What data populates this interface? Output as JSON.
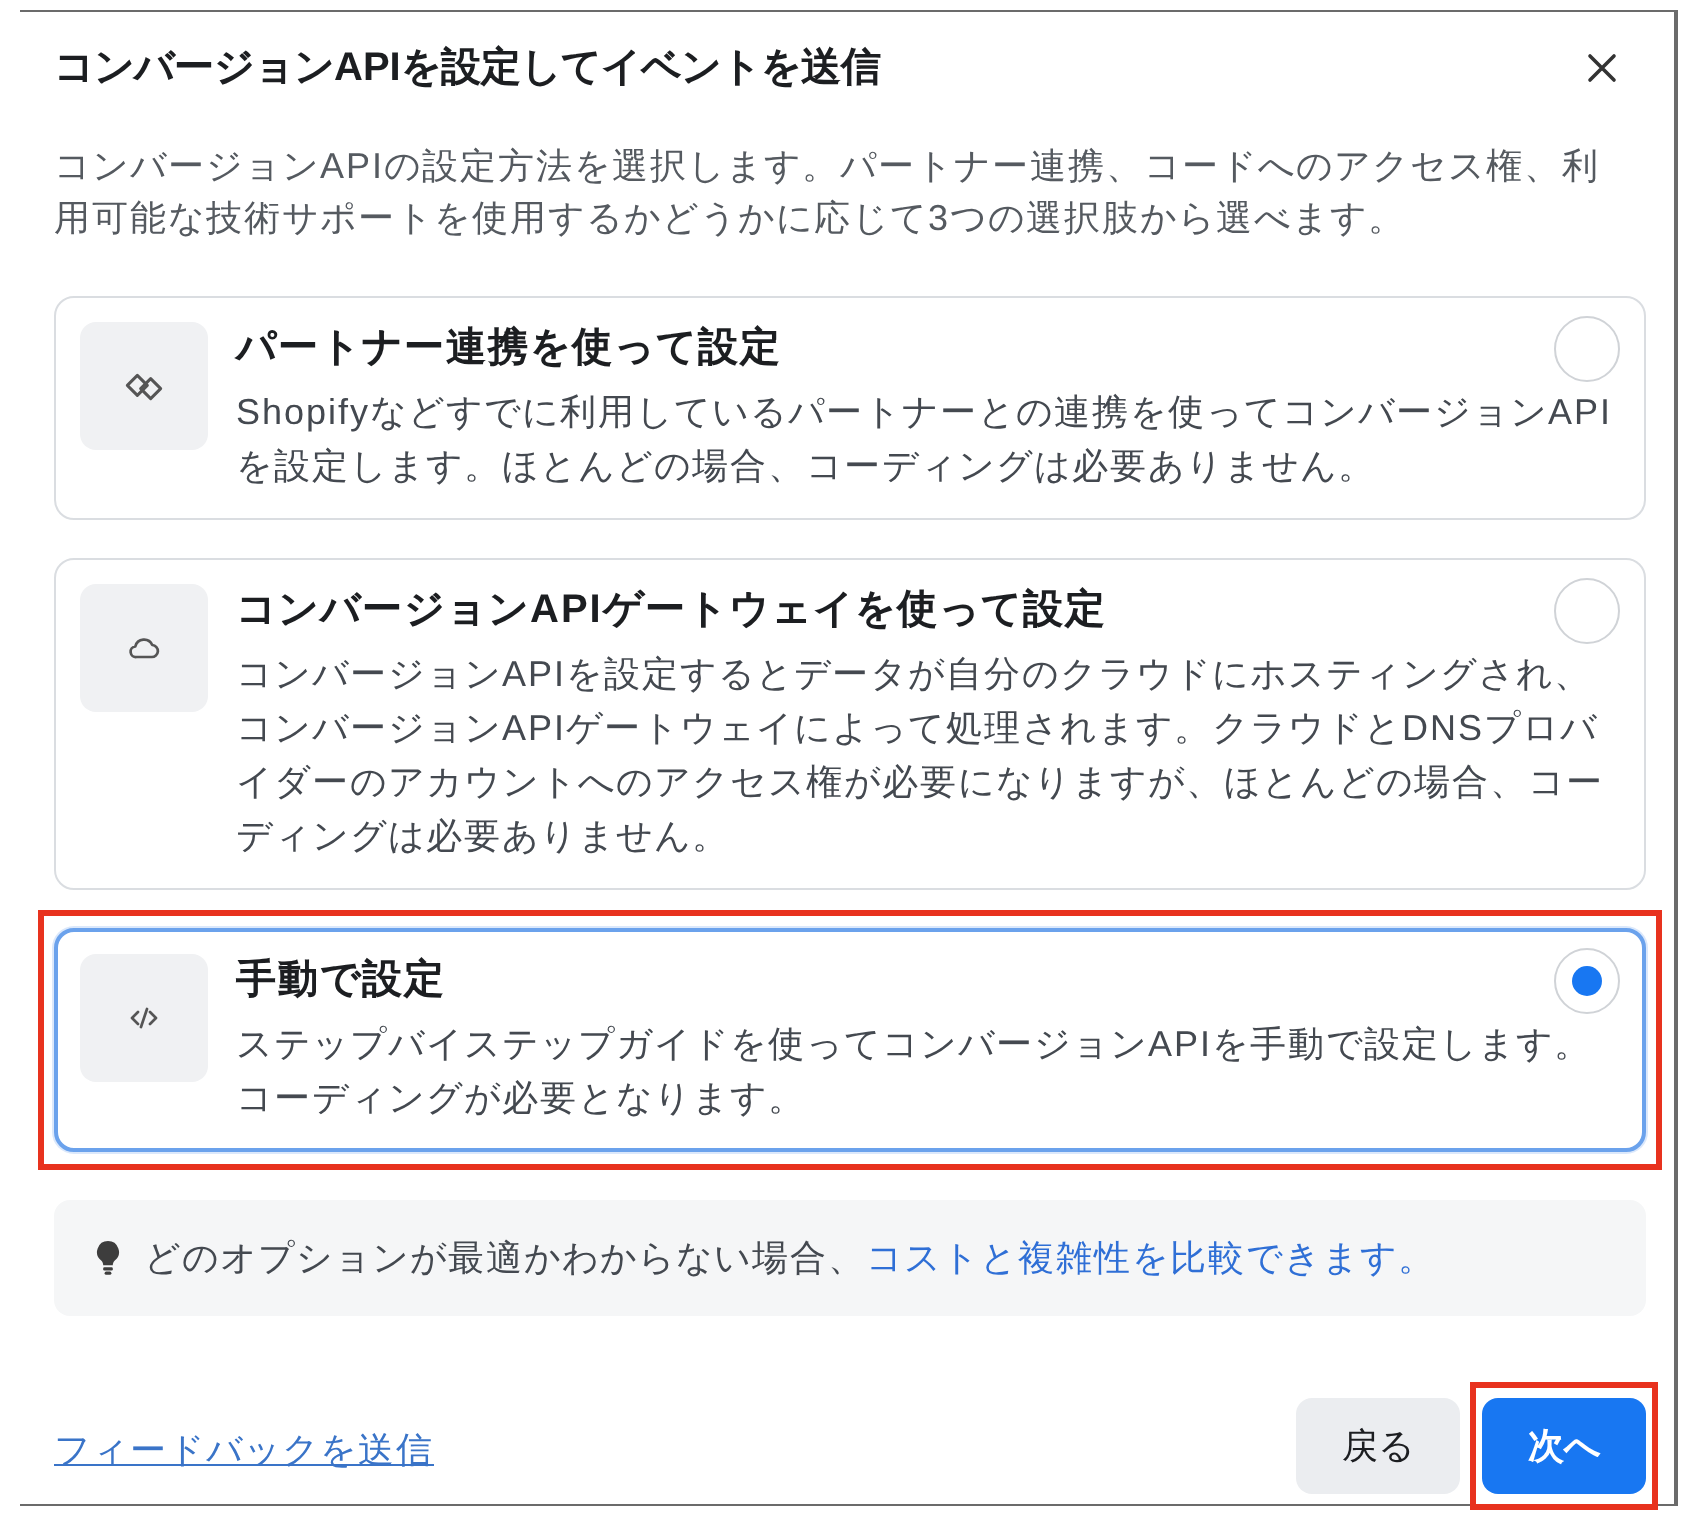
{
  "dialog": {
    "title": "コンバージョンAPIを設定してイベントを送信",
    "description": "コンバージョンAPIの設定方法を選択します。パートナー連携、コードへのアクセス権、利用可能な技術サポートを使用するかどうかに応じて3つの選択肢から選べます。"
  },
  "options": [
    {
      "title": "パートナー連携を使って設定",
      "description": "Shopifyなどすでに利用しているパートナーとの連携を使ってコンバージョンAPIを設定します。ほとんどの場合、コーディングは必要ありません。",
      "selected": false,
      "highlighted": false
    },
    {
      "title": "コンバージョンAPIゲートウェイを使って設定",
      "description": "コンバージョンAPIを設定するとデータが自分のクラウドにホスティングされ、コンバージョンAPIゲートウェイによって処理されます。クラウドとDNSプロバイダーのアカウントへのアクセス権が必要になりますが、ほとんどの場合、コーディングは必要ありません。",
      "selected": false,
      "highlighted": false
    },
    {
      "title": "手動で設定",
      "description": "ステップバイステップガイドを使ってコンバージョンAPIを手動で設定します。コーディングが必要となります。",
      "selected": true,
      "highlighted": true
    }
  ],
  "hint": {
    "text": "どのオプションが最適かわからない場合、",
    "link": "コストと複雑性を比較できます。"
  },
  "footer": {
    "feedback_link": "フィードバックを送信",
    "buttons": [
      {
        "label": "戻る",
        "kind": "secondary",
        "highlighted": false
      },
      {
        "label": "次へ",
        "kind": "primary",
        "highlighted": true
      }
    ]
  }
}
